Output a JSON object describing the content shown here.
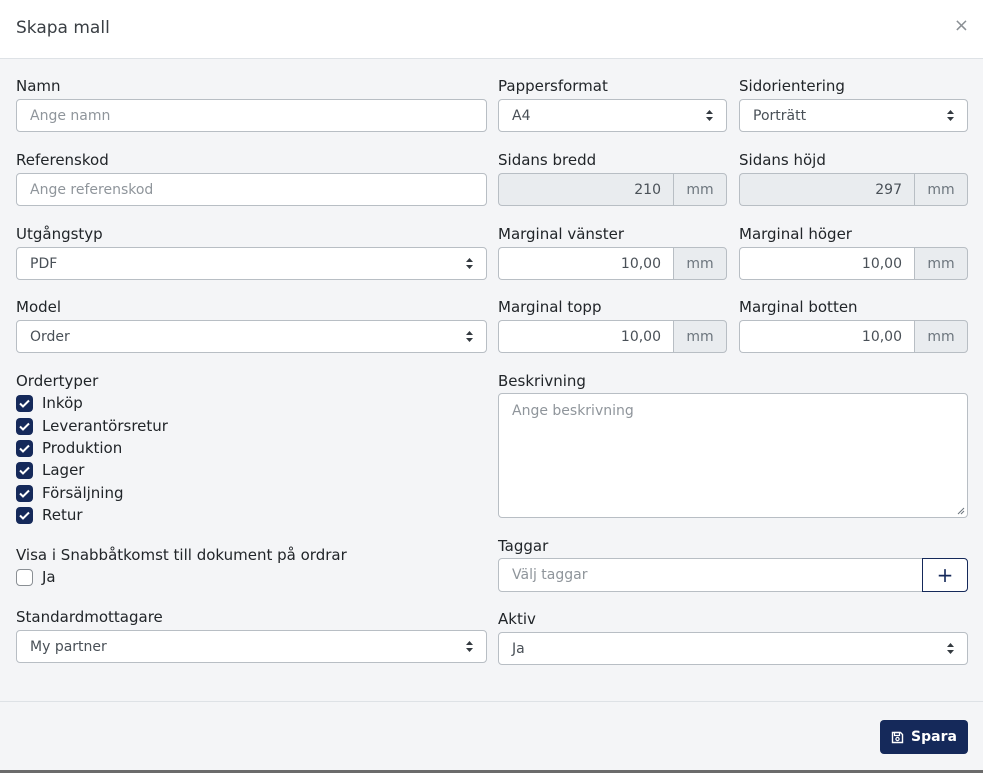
{
  "dialog": {
    "title": "Skapa mall",
    "close_label": "×"
  },
  "form": {
    "name": {
      "label": "Namn",
      "placeholder": "Ange namn"
    },
    "paper_format": {
      "label": "Pappersformat",
      "value": "A4"
    },
    "orientation": {
      "label": "Sidorientering",
      "value": "Porträtt"
    },
    "reference": {
      "label": "Referenskod",
      "placeholder": "Ange referenskod"
    },
    "page_width": {
      "label": "Sidans bredd",
      "value": "210",
      "unit": "mm"
    },
    "page_height": {
      "label": "Sidans höjd",
      "value": "297",
      "unit": "mm"
    },
    "output_type": {
      "label": "Utgångstyp",
      "value": "PDF"
    },
    "margin_left": {
      "label": "Marginal vänster",
      "value": "10,00",
      "unit": "mm"
    },
    "margin_right": {
      "label": "Marginal höger",
      "value": "10,00",
      "unit": "mm"
    },
    "model": {
      "label": "Model",
      "value": "Order"
    },
    "margin_top": {
      "label": "Marginal topp",
      "value": "10,00",
      "unit": "mm"
    },
    "margin_bottom": {
      "label": "Marginal botten",
      "value": "10,00",
      "unit": "mm"
    },
    "order_types": {
      "label": "Ordertyper",
      "items": [
        {
          "label": "Inköp",
          "checked": true
        },
        {
          "label": "Leverantörsretur",
          "checked": true
        },
        {
          "label": "Produktion",
          "checked": true
        },
        {
          "label": "Lager",
          "checked": true
        },
        {
          "label": "Försäljning",
          "checked": true
        },
        {
          "label": "Retur",
          "checked": true
        }
      ]
    },
    "description": {
      "label": "Beskrivning",
      "placeholder": "Ange beskrivning"
    },
    "quick_access": {
      "label": "Visa i Snabbåtkomst till dokument på ordrar",
      "option_label": "Ja",
      "checked": false
    },
    "tags": {
      "label": "Taggar",
      "placeholder": "Välj taggar",
      "add_label": "+"
    },
    "default_recipient": {
      "label": "Standardmottagare",
      "value": "My partner"
    },
    "active": {
      "label": "Aktiv",
      "value": "Ja"
    }
  },
  "footer": {
    "save_label": "Spara"
  },
  "colors": {
    "primary": "#15295a",
    "background": "#f4f5f7",
    "border": "#b8bec4",
    "disabled": "#e9ecef"
  },
  "icons": {
    "close": "close-icon",
    "select": "select-caret-icon",
    "check": "check-icon",
    "save": "save-icon",
    "add": "plus-icon"
  }
}
